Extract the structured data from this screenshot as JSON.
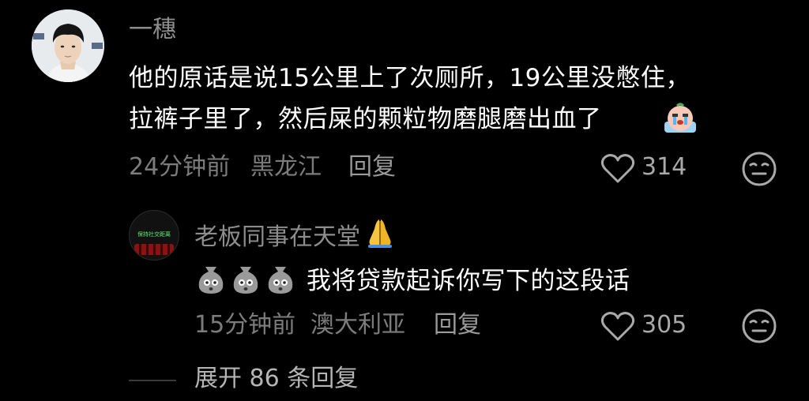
{
  "comment": {
    "username": "一穗",
    "text_line1": "他的原话是说15公里上了次厕所，19公里没憋住，",
    "text_line2": "拉裤子里了，然后屎的颗粒物磨腿磨出血了",
    "time": "24分钟前",
    "location": "黑龙江",
    "reply_label": "回复",
    "likes": "314",
    "icons": [
      "avatar-photo",
      "crying-emoji",
      "heart-icon",
      "meh-face-icon"
    ]
  },
  "reply": {
    "username": "老板同事在天堂",
    "avatar_text": "保持社交距离",
    "text": "我将贷款起诉你写下的这段话",
    "time": "15分钟前",
    "location": "澳大利亚",
    "reply_label": "回复",
    "likes": "305",
    "icons": [
      "avatar-cinema",
      "pray-emoji",
      "sack-face-emoji",
      "heart-icon",
      "meh-face-icon"
    ]
  },
  "expand": {
    "label": "展开 86 条回复"
  },
  "colors": {
    "background": "#000000",
    "text": "#ffffff",
    "muted": "#7c7c7c",
    "username": "#8d8d8d"
  }
}
